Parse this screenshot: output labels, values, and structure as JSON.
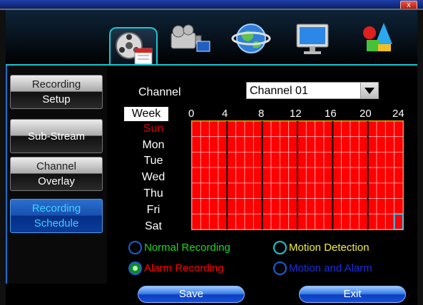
{
  "window": {
    "close_label": "x"
  },
  "tabs": [
    {
      "icon": "film-reel-icon"
    },
    {
      "icon": "video-camera-icon"
    },
    {
      "icon": "globe-network-icon"
    },
    {
      "icon": "monitor-icon"
    },
    {
      "icon": "system-shapes-icon"
    }
  ],
  "sidebar": {
    "items": [
      {
        "line1": "Recording",
        "line2": "Setup",
        "active": false
      },
      {
        "line1": "Sub-Stream",
        "line2": "",
        "active": false
      },
      {
        "line1": "Channel",
        "line2": "Overlay",
        "active": false
      },
      {
        "line1": "Recording",
        "line2": "Schedule",
        "active": true
      }
    ]
  },
  "channel": {
    "label": "Channel",
    "selected": "Channel 01"
  },
  "schedule": {
    "week_label": "Week",
    "hours": [
      "0",
      "4",
      "8",
      "12",
      "16",
      "20",
      "24"
    ],
    "days": [
      "Sun",
      "Mon",
      "Tue",
      "Wed",
      "Thu",
      "Fri",
      "Sat"
    ],
    "grid_color": "#ff0000",
    "selected_cell": {
      "day": "Sat",
      "hour": 23
    }
  },
  "legend": {
    "normal": {
      "label": "Normal Recording",
      "color": "#1fd61f",
      "checked": false
    },
    "motion": {
      "label": "Motion Detection",
      "color": "#f5f02a",
      "checked": false
    },
    "alarm": {
      "label": "Alarm Recording",
      "color": "#ff0000",
      "checked": true
    },
    "motion_alarm": {
      "label": "Motion and Alarm",
      "color": "#1a2fe0",
      "checked": false
    }
  },
  "buttons": {
    "save": "Save",
    "exit": "Exit"
  }
}
